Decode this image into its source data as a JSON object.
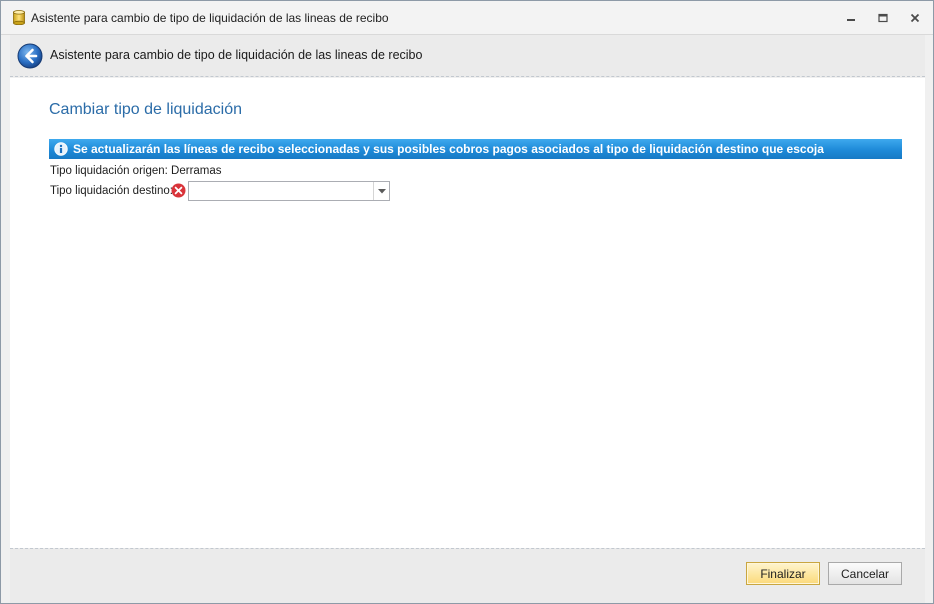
{
  "window": {
    "title": "Asistente para cambio de tipo de liquidación de las lineas de recibo",
    "icon": "database-cylinder-icon"
  },
  "header": {
    "title": "Asistente para cambio de tipo de liquidación de las lineas de recibo",
    "back_icon": "back-arrow-icon"
  },
  "main": {
    "section_title": "Cambiar tipo de liquidación",
    "info_message": "Se actualizarán las líneas de recibo seleccionadas y sus posibles cobros pagos asociados al tipo de liquidación destino que escoja",
    "origin_label": "Tipo liquidación origen: Derramas",
    "dest_label": "Tipo liquidación destino:",
    "dest_value": ""
  },
  "footer": {
    "finish_label": "Finalizar",
    "cancel_label": "Cancelar"
  },
  "colors": {
    "accent": "#2b6ca8",
    "info_bar": "#1e8ad8",
    "error": "#d9343a",
    "finish_button": "#fde8a3"
  }
}
